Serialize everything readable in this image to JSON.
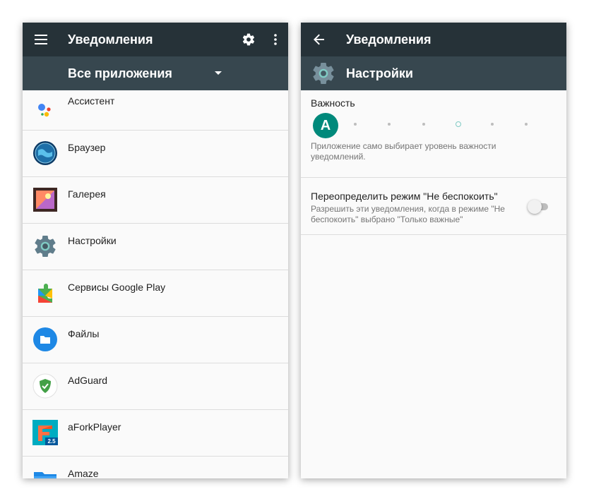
{
  "left": {
    "appbar": {
      "title": "Уведомления",
      "menu_icon": "hamburger-menu-icon",
      "settings_icon": "gear-icon",
      "overflow_icon": "more-vert-icon"
    },
    "filter": {
      "label": "Все приложения",
      "arrow_icon": "dropdown-arrow-icon"
    },
    "apps": [
      {
        "label": "Ассистент",
        "icon": "assistant-icon"
      },
      {
        "label": "Браузер",
        "icon": "browser-globe-icon"
      },
      {
        "label": "Галерея",
        "icon": "gallery-icon"
      },
      {
        "label": "Настройки",
        "icon": "settings-gear-icon"
      },
      {
        "label": "Сервисы Google Play",
        "icon": "google-play-services-icon"
      },
      {
        "label": "Файлы",
        "icon": "files-folder-icon"
      },
      {
        "label": "AdGuard",
        "icon": "adguard-shield-icon"
      },
      {
        "label": "aForkPlayer",
        "icon": "aforkplayer-icon"
      },
      {
        "label": "Amaze",
        "icon": "amaze-folder-icon"
      }
    ],
    "aforkplayer_badge": "2.5"
  },
  "right": {
    "appbar": {
      "title": "Уведомления",
      "back_icon": "back-arrow-icon"
    },
    "header": {
      "title": "Настройки",
      "icon": "settings-gear-icon"
    },
    "importance": {
      "label": "Важность",
      "avatar_letter": "A",
      "description_line1": "Приложение само выбирает уровень важности",
      "description_line2": "уведомлений."
    },
    "dnd": {
      "label": "Переопределить режим \"Не беспокоить\"",
      "description_line1": "Разрешить эти уведомления, когда в режиме \"Не",
      "description_line2": "беспокоить\" выбрано \"Только важные\""
    }
  }
}
